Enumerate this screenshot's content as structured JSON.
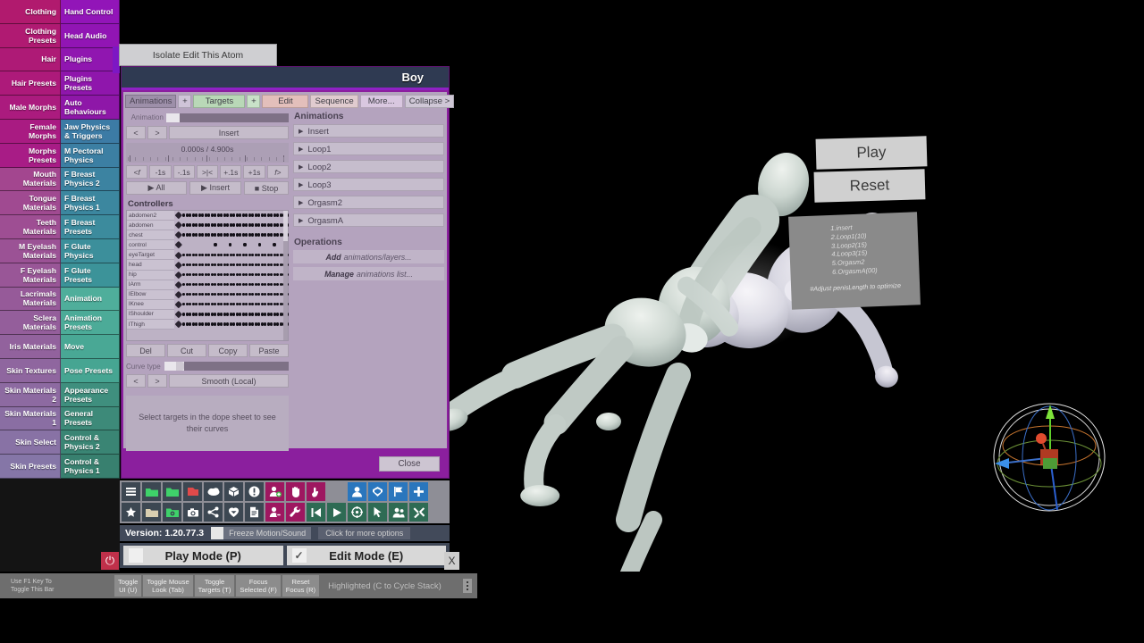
{
  "sidebar": {
    "left_column": [
      {
        "label": "Clothing",
        "color": "#b11a6e"
      },
      {
        "label": "Clothing Presets",
        "color": "#b01a72"
      },
      {
        "label": "Hair",
        "color": "#ae1a76"
      },
      {
        "label": "Hair Presets",
        "color": "#ad1a7a"
      },
      {
        "label": "Male Morphs",
        "color": "#ab1b7e"
      },
      {
        "label": "Female Morphs",
        "color": "#a91b82"
      },
      {
        "label": "Morphs Presets",
        "color": "#a81c86"
      },
      {
        "label": "Mouth Materials",
        "color": "#a3468f"
      },
      {
        "label": "Tongue Materials",
        "color": "#a04a91"
      },
      {
        "label": "Teeth Materials",
        "color": "#9e4e93"
      },
      {
        "label": "M Eyelash Materials",
        "color": "#9b5295"
      },
      {
        "label": "F Eyelash Materials",
        "color": "#995697"
      },
      {
        "label": "Lacrimals Materials",
        "color": "#965a99"
      },
      {
        "label": "Sclera Materials",
        "color": "#945e9b"
      },
      {
        "label": "Iris Materials",
        "color": "#92629d"
      },
      {
        "label": "Skin Textures",
        "color": "#8f669f"
      },
      {
        "label": "Skin Materials 2",
        "color": "#8d6aa1"
      },
      {
        "label": "Skin Materials 1",
        "color": "#8a6ea3"
      },
      {
        "label": "Skin Select",
        "color": "#8872a5"
      },
      {
        "label": "Skin Presets",
        "color": "#8576a7"
      }
    ],
    "right_column": [
      {
        "label": "Hand Control",
        "color": "#9215b8"
      },
      {
        "label": "Head Audio",
        "color": "#9115b4"
      },
      {
        "label": "Plugins",
        "color": "#9016b0"
      },
      {
        "label": "Plugins Presets",
        "color": "#8f16ac"
      },
      {
        "label": "Auto Behaviours",
        "color": "#8e17a8"
      },
      {
        "label": "Jaw Physics & Triggers",
        "color": "#3c7ba5"
      },
      {
        "label": "M Pectoral Physics",
        "color": "#3c7fa3"
      },
      {
        "label": "F Breast Physics 2",
        "color": "#3c83a1"
      },
      {
        "label": "F Breast Physics 1",
        "color": "#3c879f"
      },
      {
        "label": "F Breast Presets",
        "color": "#3c8b9d"
      },
      {
        "label": "F Glute Physics",
        "color": "#3c8f9b"
      },
      {
        "label": "F Glute Presets",
        "color": "#3c9399"
      },
      {
        "label": "Animation",
        "color": "#4fae9b"
      },
      {
        "label": "Animation Presets",
        "color": "#4cab98"
      },
      {
        "label": "Move",
        "color": "#49a895"
      },
      {
        "label": "Pose Presets",
        "color": "#46a592"
      },
      {
        "label": "Appearance Presets",
        "color": "#3f8f7e"
      },
      {
        "label": "General Presets",
        "color": "#3d8a79"
      },
      {
        "label": "Control & Physics 2",
        "color": "#3a8574"
      },
      {
        "label": "Control & Physics 1",
        "color": "#38806f"
      }
    ]
  },
  "isolate": {
    "label": "Isolate Edit This Atom"
  },
  "panel": {
    "title": "Boy",
    "close_label": "Close",
    "tabs": [
      {
        "key": "animations",
        "label": "Animations"
      },
      {
        "key": "plus",
        "label": "+"
      },
      {
        "key": "targets",
        "label": "Targets"
      },
      {
        "key": "plus2",
        "label": "+"
      },
      {
        "key": "edit",
        "label": "Edit"
      },
      {
        "key": "sequence",
        "label": "Sequence"
      },
      {
        "key": "more",
        "label": "More..."
      },
      {
        "key": "collapse",
        "label": "Collapse >"
      }
    ],
    "animation_slider_label": "Animation",
    "prev_label": "<",
    "next_label": ">",
    "current_animation": "Insert",
    "time_readout": "0.000s / 4.900s",
    "step_buttons": [
      "<f",
      "-1s",
      "-.1s",
      ">|<",
      "+.1s",
      "+1s",
      "f>"
    ],
    "transport": {
      "all": "▶ All",
      "insert": "▶ Insert",
      "stop": "■ Stop"
    },
    "controllers_title": "Controllers",
    "controllers": [
      "abdomen2",
      "abdomen",
      "chest",
      "control",
      "eyeTarget",
      "head",
      "hip",
      "lArm",
      "lElbow",
      "lKnee",
      "lShoulder",
      "lThigh"
    ],
    "edit_buttons": [
      "Del",
      "Cut",
      "Copy",
      "Paste"
    ],
    "curve_type_label": "Curve type",
    "curve_prev": "<",
    "curve_next": ">",
    "curve_value": "Smooth (Local)",
    "curve_hint": "Select targets in the dope sheet to see their curves",
    "animations_title": "Animations",
    "animations_list": [
      "Insert",
      "Loop1",
      "Loop2",
      "Loop3",
      "Orgasm2",
      "OrgasmA"
    ],
    "operations_title": "Operations",
    "operations": [
      {
        "bold": "Add",
        "rest": "animations/layers..."
      },
      {
        "bold": "Manage",
        "rest": "animations list..."
      }
    ]
  },
  "overlay": {
    "play_label": "Play",
    "reset_label": "Reset",
    "notes": [
      "1.insert",
      "2.Loop1(10)",
      "3.Loop2(15)",
      "4.Loop3(15)",
      "5.Orgasm2",
      "6.OrgasmA(00)"
    ],
    "notes_footer": "#Adjust penisLength to optimize"
  },
  "toolbar": {
    "row1": [
      {
        "name": "menu-icon",
        "color": "#3c4752",
        "glyph": "menu"
      },
      {
        "name": "open-scene-icon",
        "color": "#3c4752",
        "glyph": "openfolder",
        "fg": "#3fd16a"
      },
      {
        "name": "folder-icon",
        "color": "#3c4752",
        "glyph": "folder",
        "fg": "#3fd16a"
      },
      {
        "name": "save-scene-icon",
        "color": "#3c4752",
        "glyph": "save",
        "fg": "#e04a4a"
      },
      {
        "name": "cloud-icon",
        "color": "#3c4752",
        "glyph": "cloud",
        "fg": "#ffffff"
      },
      {
        "name": "package-icon",
        "color": "#3c4752",
        "glyph": "box",
        "fg": "#ffffff"
      },
      {
        "name": "warning-icon",
        "color": "#3c4752",
        "glyph": "exclaim",
        "fg": "#ffffff"
      },
      {
        "name": "add-person-icon",
        "color": "#9e1760",
        "glyph": "person-plus",
        "fg": "#ffffff"
      },
      {
        "name": "hand-icon",
        "color": "#9e1760",
        "glyph": "hand",
        "fg": "#ffffff"
      },
      {
        "name": "pointer-hand-icon",
        "color": "#9e1760",
        "glyph": "cursor-hand",
        "fg": "#ffffff"
      },
      {
        "name": "spacer",
        "color": "transparent",
        "glyph": ""
      },
      {
        "name": "person-icon",
        "color": "#2a76bd",
        "glyph": "person",
        "fg": "#ffffff"
      },
      {
        "name": "unity-icon",
        "color": "#2a76bd",
        "glyph": "unity",
        "fg": "#ffffff"
      },
      {
        "name": "flag-icon",
        "color": "#2a76bd",
        "glyph": "flag",
        "fg": "#ffffff"
      },
      {
        "name": "plus-icon",
        "color": "#2a76bd",
        "glyph": "plus",
        "fg": "#ffffff"
      }
    ],
    "row2": [
      {
        "name": "favorite-icon",
        "color": "#3c4752",
        "glyph": "star",
        "fg": "#ffffff"
      },
      {
        "name": "load-preset-icon",
        "color": "#3c4752",
        "glyph": "openfolder",
        "fg": "#d8cdb0"
      },
      {
        "name": "save-preset-icon",
        "color": "#3c4752",
        "glyph": "folder-gear",
        "fg": "#3fd16a"
      },
      {
        "name": "screenshot-icon",
        "color": "#3c4752",
        "glyph": "camera",
        "fg": "#ffffff"
      },
      {
        "name": "share-icon",
        "color": "#3c4752",
        "glyph": "share",
        "fg": "#ffffff"
      },
      {
        "name": "hub-icon",
        "color": "#3c4752",
        "glyph": "hub",
        "fg": "#ffffff"
      },
      {
        "name": "log-icon",
        "color": "#3c4752",
        "glyph": "document",
        "fg": "#ffffff"
      },
      {
        "name": "remove-person-icon",
        "color": "#9e1760",
        "glyph": "person-minus",
        "fg": "#ffffff"
      },
      {
        "name": "wrench-icon",
        "color": "#9e1760",
        "glyph": "wrench",
        "fg": "#ffffff"
      },
      {
        "name": "skip-back-icon",
        "color": "#2e6b54",
        "glyph": "skipback",
        "fg": "#ffffff"
      },
      {
        "name": "play-icon",
        "color": "#2e6b54",
        "glyph": "play",
        "fg": "#ffffff"
      },
      {
        "name": "target-icon",
        "color": "#2e6b54",
        "glyph": "target",
        "fg": "#ffffff"
      },
      {
        "name": "select-icon",
        "color": "#2e6b54",
        "glyph": "arrow",
        "fg": "#ffffff"
      },
      {
        "name": "people-icon",
        "color": "#2e6b54",
        "glyph": "people",
        "fg": "#ffffff"
      },
      {
        "name": "tools-icon",
        "color": "#2e6b54",
        "glyph": "tools",
        "fg": "#ffffff"
      }
    ]
  },
  "statusbar": {
    "version": "Version: 1.20.77.3",
    "freeze_label": "Freeze Motion/Sound",
    "more_options": "Click for more options",
    "play_mode": "Play Mode (P)",
    "edit_mode": "Edit Mode (E)",
    "edit_mode_checked": "✓",
    "power_glyph": "⏻",
    "close_x": "X"
  },
  "helpbar": {
    "hint_line1": "Use F1 Key To",
    "hint_line2": "Toggle This Bar",
    "buttons": [
      {
        "line1": "Toggle",
        "line2": "UI (U)"
      },
      {
        "line1": "Toggle Mouse",
        "line2": "Look (Tab)"
      },
      {
        "line1": "Toggle",
        "line2": "Targets (T)"
      },
      {
        "line1": "Focus",
        "line2": "Selected (F)"
      },
      {
        "line1": "Reset",
        "line2": "Focus (R)"
      }
    ],
    "status": "Highlighted (C to Cycle Stack)"
  }
}
